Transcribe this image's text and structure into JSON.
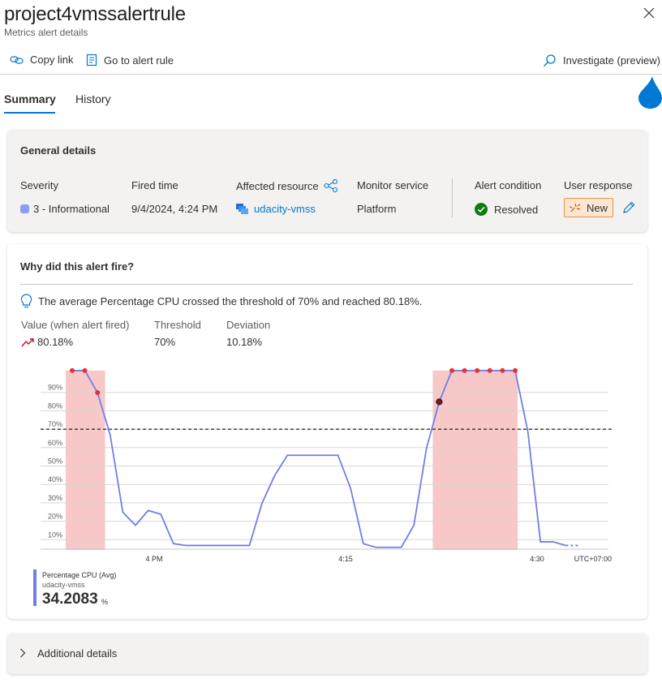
{
  "header": {
    "title": "project4vmssalertrule",
    "subtitle": "Metrics alert details"
  },
  "toolbar": {
    "copy_link": "Copy link",
    "go_to_rule": "Go to alert rule",
    "investigate": "Investigate (preview)"
  },
  "tabs": [
    {
      "label": "Summary",
      "active": true
    },
    {
      "label": "History",
      "active": false
    }
  ],
  "general": {
    "title": "General details",
    "severity_label": "Severity",
    "severity_value": "3 - Informational",
    "fired_label": "Fired time",
    "fired_value": "9/4/2024, 4:24 PM",
    "resource_label": "Affected resource",
    "resource_value": "udacity-vmss",
    "monitor_label": "Monitor service",
    "monitor_value": "Platform",
    "condition_label": "Alert condition",
    "condition_value": "Resolved",
    "response_label": "User response",
    "response_value": "New"
  },
  "why": {
    "title": "Why did this alert fire?",
    "info": "The average Percentage CPU crossed the threshold of 70% and reached 80.18%.",
    "value_label": "Value (when alert fired)",
    "value": "80.18%",
    "threshold_label": "Threshold",
    "threshold": "70%",
    "deviation_label": "Deviation",
    "deviation": "10.18%"
  },
  "legend": {
    "name": "Percentage CPU (Avg)",
    "resource": "udacity-vmss",
    "value": "34.2083",
    "unit": "%"
  },
  "additional": {
    "label": "Additional details"
  },
  "colors": {
    "accent": "#0078d4",
    "series": "#6f7fe8",
    "alert_region": "#f8c8c8",
    "alert_point": "#e8303a",
    "resolved": "#107c10"
  },
  "chart_data": {
    "type": "line",
    "ytick_labels": [
      "10%",
      "20%",
      "30%",
      "40%",
      "50%",
      "60%",
      "70%",
      "80%",
      "90%"
    ],
    "yticks": [
      10,
      20,
      30,
      40,
      50,
      60,
      70,
      80,
      90
    ],
    "ylim": [
      0,
      100
    ],
    "xtick_labels": [
      "4 PM",
      "4:15",
      "4:30"
    ],
    "timezone": "UTC+07:00",
    "threshold": 70,
    "series": [
      {
        "name": "Percentage CPU (Avg)",
        "x": [
          0,
          1,
          2,
          3,
          4,
          5,
          6,
          7,
          8,
          9,
          10,
          11,
          12,
          13,
          14,
          15,
          16,
          17,
          18,
          19,
          20,
          21,
          22,
          23,
          24,
          25,
          26,
          27,
          28,
          29,
          30,
          31,
          32,
          33,
          34,
          35,
          36,
          37,
          38,
          39,
          40
        ],
        "y": [
          97,
          97,
          85,
          62,
          20,
          13,
          21,
          19,
          3,
          2,
          2,
          2,
          2,
          2,
          2,
          25,
          40,
          51,
          51,
          51,
          51,
          51,
          33,
          3,
          1,
          1,
          1,
          13,
          55,
          80,
          97,
          97,
          97,
          97,
          97,
          97,
          64,
          4,
          4,
          2,
          2
        ]
      }
    ],
    "alert_regions": [
      [
        0,
        2.6
      ],
      [
        29,
        35.2
      ]
    ],
    "alert_points_x": [
      0,
      1,
      2,
      29,
      30,
      31,
      32,
      33,
      34,
      35
    ]
  }
}
